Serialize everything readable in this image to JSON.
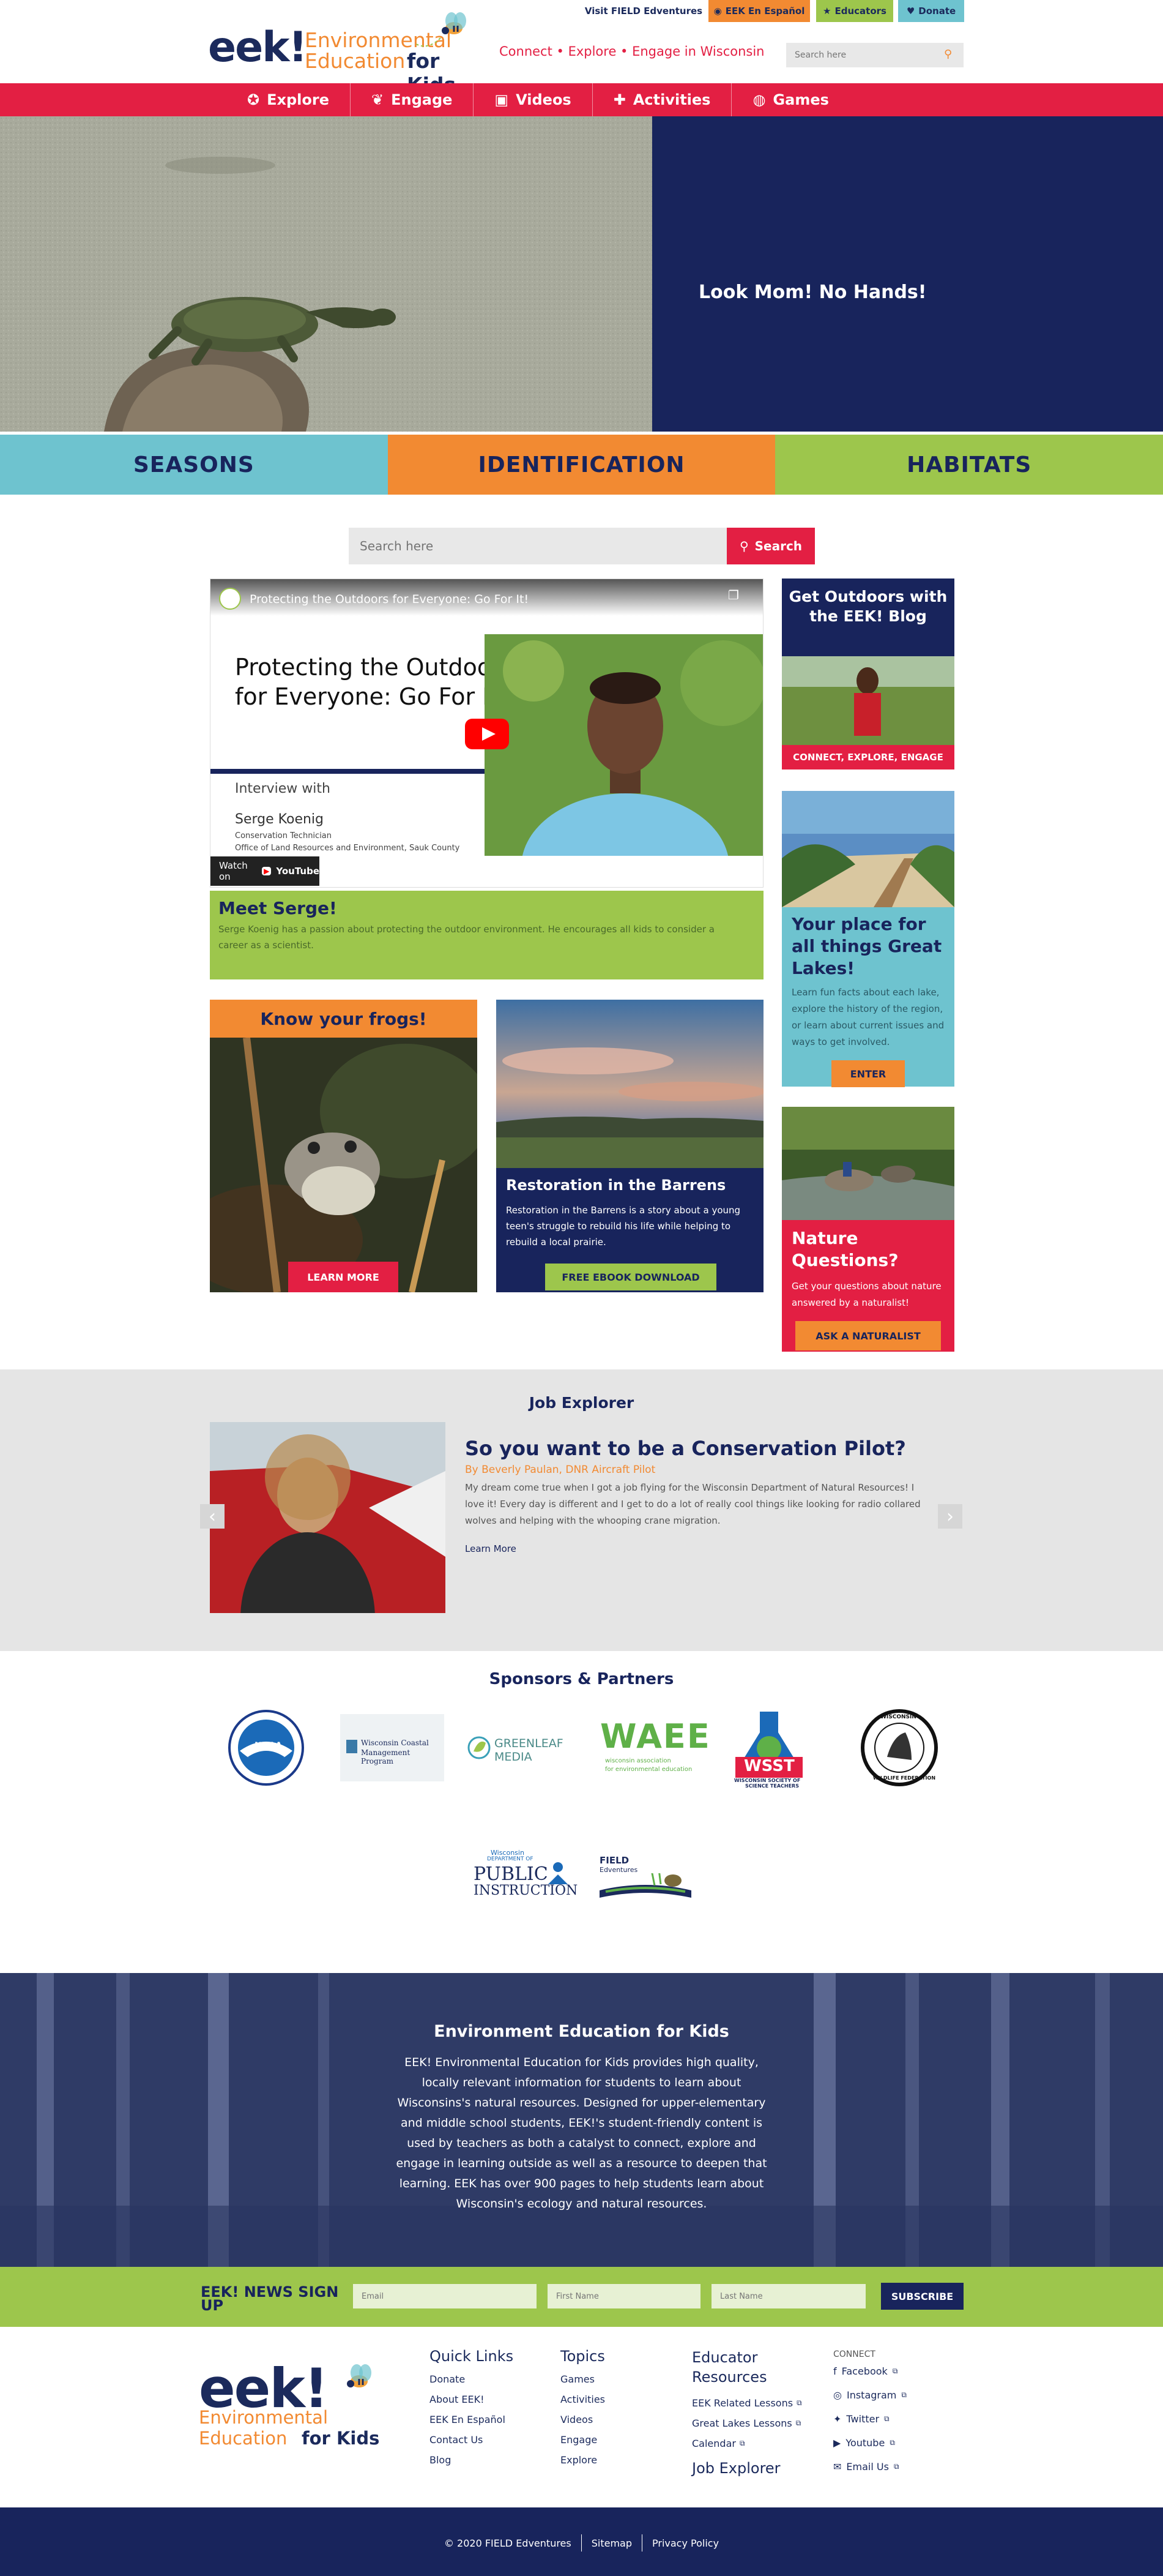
{
  "topbar": {
    "visit_link": "Visit FIELD Edventures",
    "espanol": "EEK En Español",
    "educators": "Educators",
    "donate": "Donate",
    "colors": {
      "espanol": "#f28a32",
      "educators": "#9dc64c",
      "donate": "#6ec3cf"
    }
  },
  "header": {
    "logo_eek": "eek!",
    "logo_line1": "Environmental",
    "logo_line2_a": "Education",
    "logo_line2_b": "for Kids",
    "tagline": "Connect • Explore • Engage in Wisconsin",
    "search_placeholder": "Search here"
  },
  "nav": {
    "items": [
      {
        "label": "Explore",
        "icon": "compass-icon"
      },
      {
        "label": "Engage",
        "icon": "sprout-icon"
      },
      {
        "label": "Videos",
        "icon": "camera-icon"
      },
      {
        "label": "Activities",
        "icon": "puzzle-icon"
      },
      {
        "label": "Games",
        "icon": "gamepad-icon"
      }
    ],
    "color": "#e31f43"
  },
  "hero": {
    "caption": "Look Mom! No Hands!",
    "image": "turtle-on-log-photo"
  },
  "categories": {
    "items": [
      {
        "label": "SEASONS",
        "color": "#6ec3cf"
      },
      {
        "label": "IDENTIFICATION",
        "color": "#f28a32"
      },
      {
        "label": "HABITATS",
        "color": "#9dc64c"
      }
    ]
  },
  "main_search": {
    "placeholder": "Search here",
    "button": "Search"
  },
  "video": {
    "title_bar": "Protecting the Outdoors for Everyone: Go For It!",
    "slide_title_1": "Protecting the Outdoors",
    "slide_title_2": "for Everyone: Go For It!",
    "interview": "Interview with",
    "name": "Serge Koenig",
    "role_1": "Conservation Technician",
    "role_2": "Office of Land Resources and Environment, Sauk County",
    "watch_on": "Watch on",
    "youtube": "YouTube"
  },
  "meet": {
    "title": "Meet Serge!",
    "text": "Serge Koenig has a passion about protecting the outdoor environment. He encourages all kids to consider a career as a scientist."
  },
  "frogs": {
    "title": "Know your frogs!",
    "button": "LEARN MORE"
  },
  "barrens": {
    "title": "Restoration in the Barrens",
    "text": "Restoration in the Barrens is a story about a young teen's struggle to rebuild his life while helping to rebuild a local prairie.",
    "button": "FREE EBOOK DOWNLOAD"
  },
  "sidebar": {
    "blog_title": "Get Outdoors with the EEK! Blog",
    "blog_caption": "CONNECT, EXPLORE, ENGAGE",
    "lakes_title": "Your place for all things Great Lakes!",
    "lakes_text": "Learn fun facts about each lake, explore the history of the region, or learn about current issues and ways to get involved.",
    "lakes_button": "ENTER",
    "nature_title": "Nature Questions?",
    "nature_text": "Get your questions about nature answered by a naturalist!",
    "nature_button": "ASK A NATURALIST"
  },
  "job": {
    "section_title": "Job Explorer",
    "title": "So you want to be a Conservation Pilot?",
    "byline": "By Beverly Paulan, DNR Aircraft Pilot",
    "text": "My dream come true when I got a job flying for the Wisconsin Department of Natural Resources! I love it! Every day is different and I get to do a lot of really cool things like looking for radio collared wolves and helping with the whooping crane migration.",
    "link": "Learn More",
    "prev": "‹",
    "next": "›"
  },
  "sponsors": {
    "title": "Sponsors & Partners",
    "items": [
      {
        "name": "NOAA"
      },
      {
        "name": "Wisconsin Coastal Management Program",
        "line1": "Wisconsin Coastal",
        "line2": "Management Program"
      },
      {
        "name": "Greenleaf Media",
        "line1": "GREENLEAF",
        "line2": "MEDIA"
      },
      {
        "name": "WAEE",
        "line1": "WAEE",
        "line2": "wisconsin association",
        "line3": "for environmental education"
      },
      {
        "name": "WSST",
        "line1": "WSST",
        "line2": "WISCONSIN SOCIETY OF",
        "line3": "SCIENCE TEACHERS"
      },
      {
        "name": "Wisconsin Wildlife Federation",
        "line1": "WISCONSIN",
        "line2": "WILDLIFE FEDERATION"
      },
      {
        "name": "Wisconsin Department of Public Instruction",
        "line1": "Wisconsin",
        "line2": "DEPARTMENT OF",
        "line3": "PUBLIC",
        "line4": "INSTRUCTION"
      },
      {
        "name": "FIELD Edventures",
        "line1": "FIELD",
        "line2": "Edventures"
      }
    ]
  },
  "about": {
    "title": "Environment Education for Kids",
    "text": "EEK! Environmental Education for Kids provides high quality, locally relevant information for students to learn about Wisconsins's natural resources. Designed for upper-elementary and middle school students, EEK!'s student-friendly content is used by teachers as both a catalyst to connect, explore and engage in learning outside as well as a resource to deepen that learning. EEK has over 900 pages to help students learn about Wisconsin's ecology and natural resources."
  },
  "newsletter": {
    "title": "EEK! NEWS SIGN UP",
    "email_placeholder": "Email",
    "first_placeholder": "First Name",
    "last_placeholder": "Last Name",
    "button": "SUBSCRIBE"
  },
  "footer": {
    "quick_links_title": "Quick Links",
    "quick_links": [
      "Donate",
      "About EEK!",
      "EEK En Español",
      "Contact Us",
      "Blog"
    ],
    "topics_title": "Topics",
    "topics": [
      "Games",
      "Activities",
      "Videos",
      "Engage",
      "Explore"
    ],
    "resources_title": "Educator Resources",
    "resources": [
      "EEK Related Lessons",
      "Great Lakes Lessons",
      "Calendar"
    ],
    "job_explorer": "Job Explorer",
    "connect_title": "CONNECT",
    "social": [
      {
        "label": "Facebook",
        "icon": "facebook-icon",
        "glyph": "f"
      },
      {
        "label": "Instagram",
        "icon": "instagram-icon",
        "glyph": "◎"
      },
      {
        "label": "Twitter",
        "icon": "twitter-icon",
        "glyph": "✦"
      },
      {
        "label": "Youtube",
        "icon": "youtube-icon",
        "glyph": "▶"
      },
      {
        "label": "Email Us",
        "icon": "email-icon",
        "glyph": "✉"
      }
    ]
  },
  "bottom_bar": {
    "copyright": "© 2020 FIELD Edventures",
    "sitemap": "Sitemap",
    "privacy": "Privacy Policy"
  }
}
